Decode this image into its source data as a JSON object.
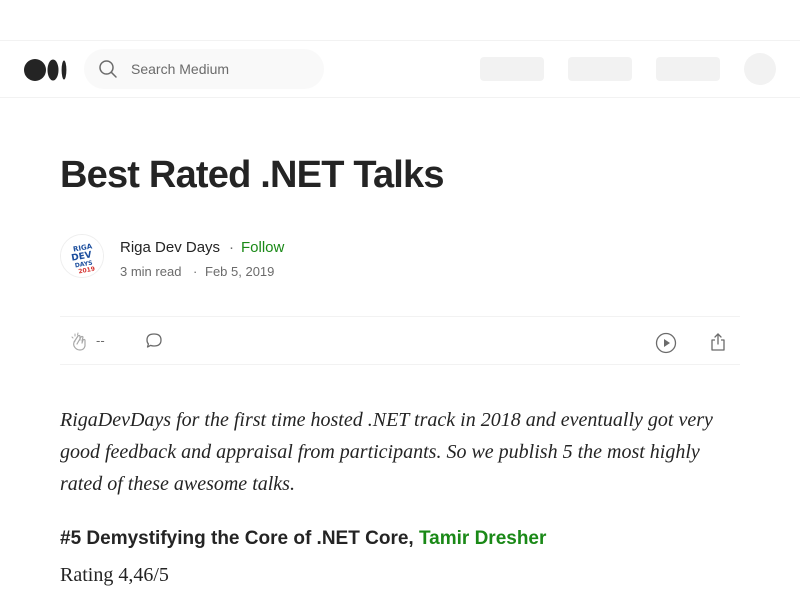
{
  "header": {
    "search_placeholder": "Search Medium"
  },
  "article": {
    "title": "Best Rated .NET Talks",
    "author": {
      "name": "Riga Dev Days",
      "separator": "·",
      "follow_label": "Follow",
      "read_time": "3 min read",
      "date": "Feb 5, 2019",
      "avatar_text": "RIGA DEV DAYS 2019"
    },
    "actions": {
      "clap_count": "--"
    },
    "intro": "RigaDevDays for the first time hosted .NET track in 2018 and eventually got very good feedback and appraisal from participants. So we publish 5 the most highly rated of these awesome talks.",
    "section": {
      "heading": "#5 Demystifying the Core of .NET Core, ",
      "speaker": "Tamir Dresher",
      "rating": "Rating 4,46/5"
    }
  },
  "colors": {
    "accent": "#1a8917",
    "text": "#242424",
    "muted": "#6b6b6b"
  }
}
